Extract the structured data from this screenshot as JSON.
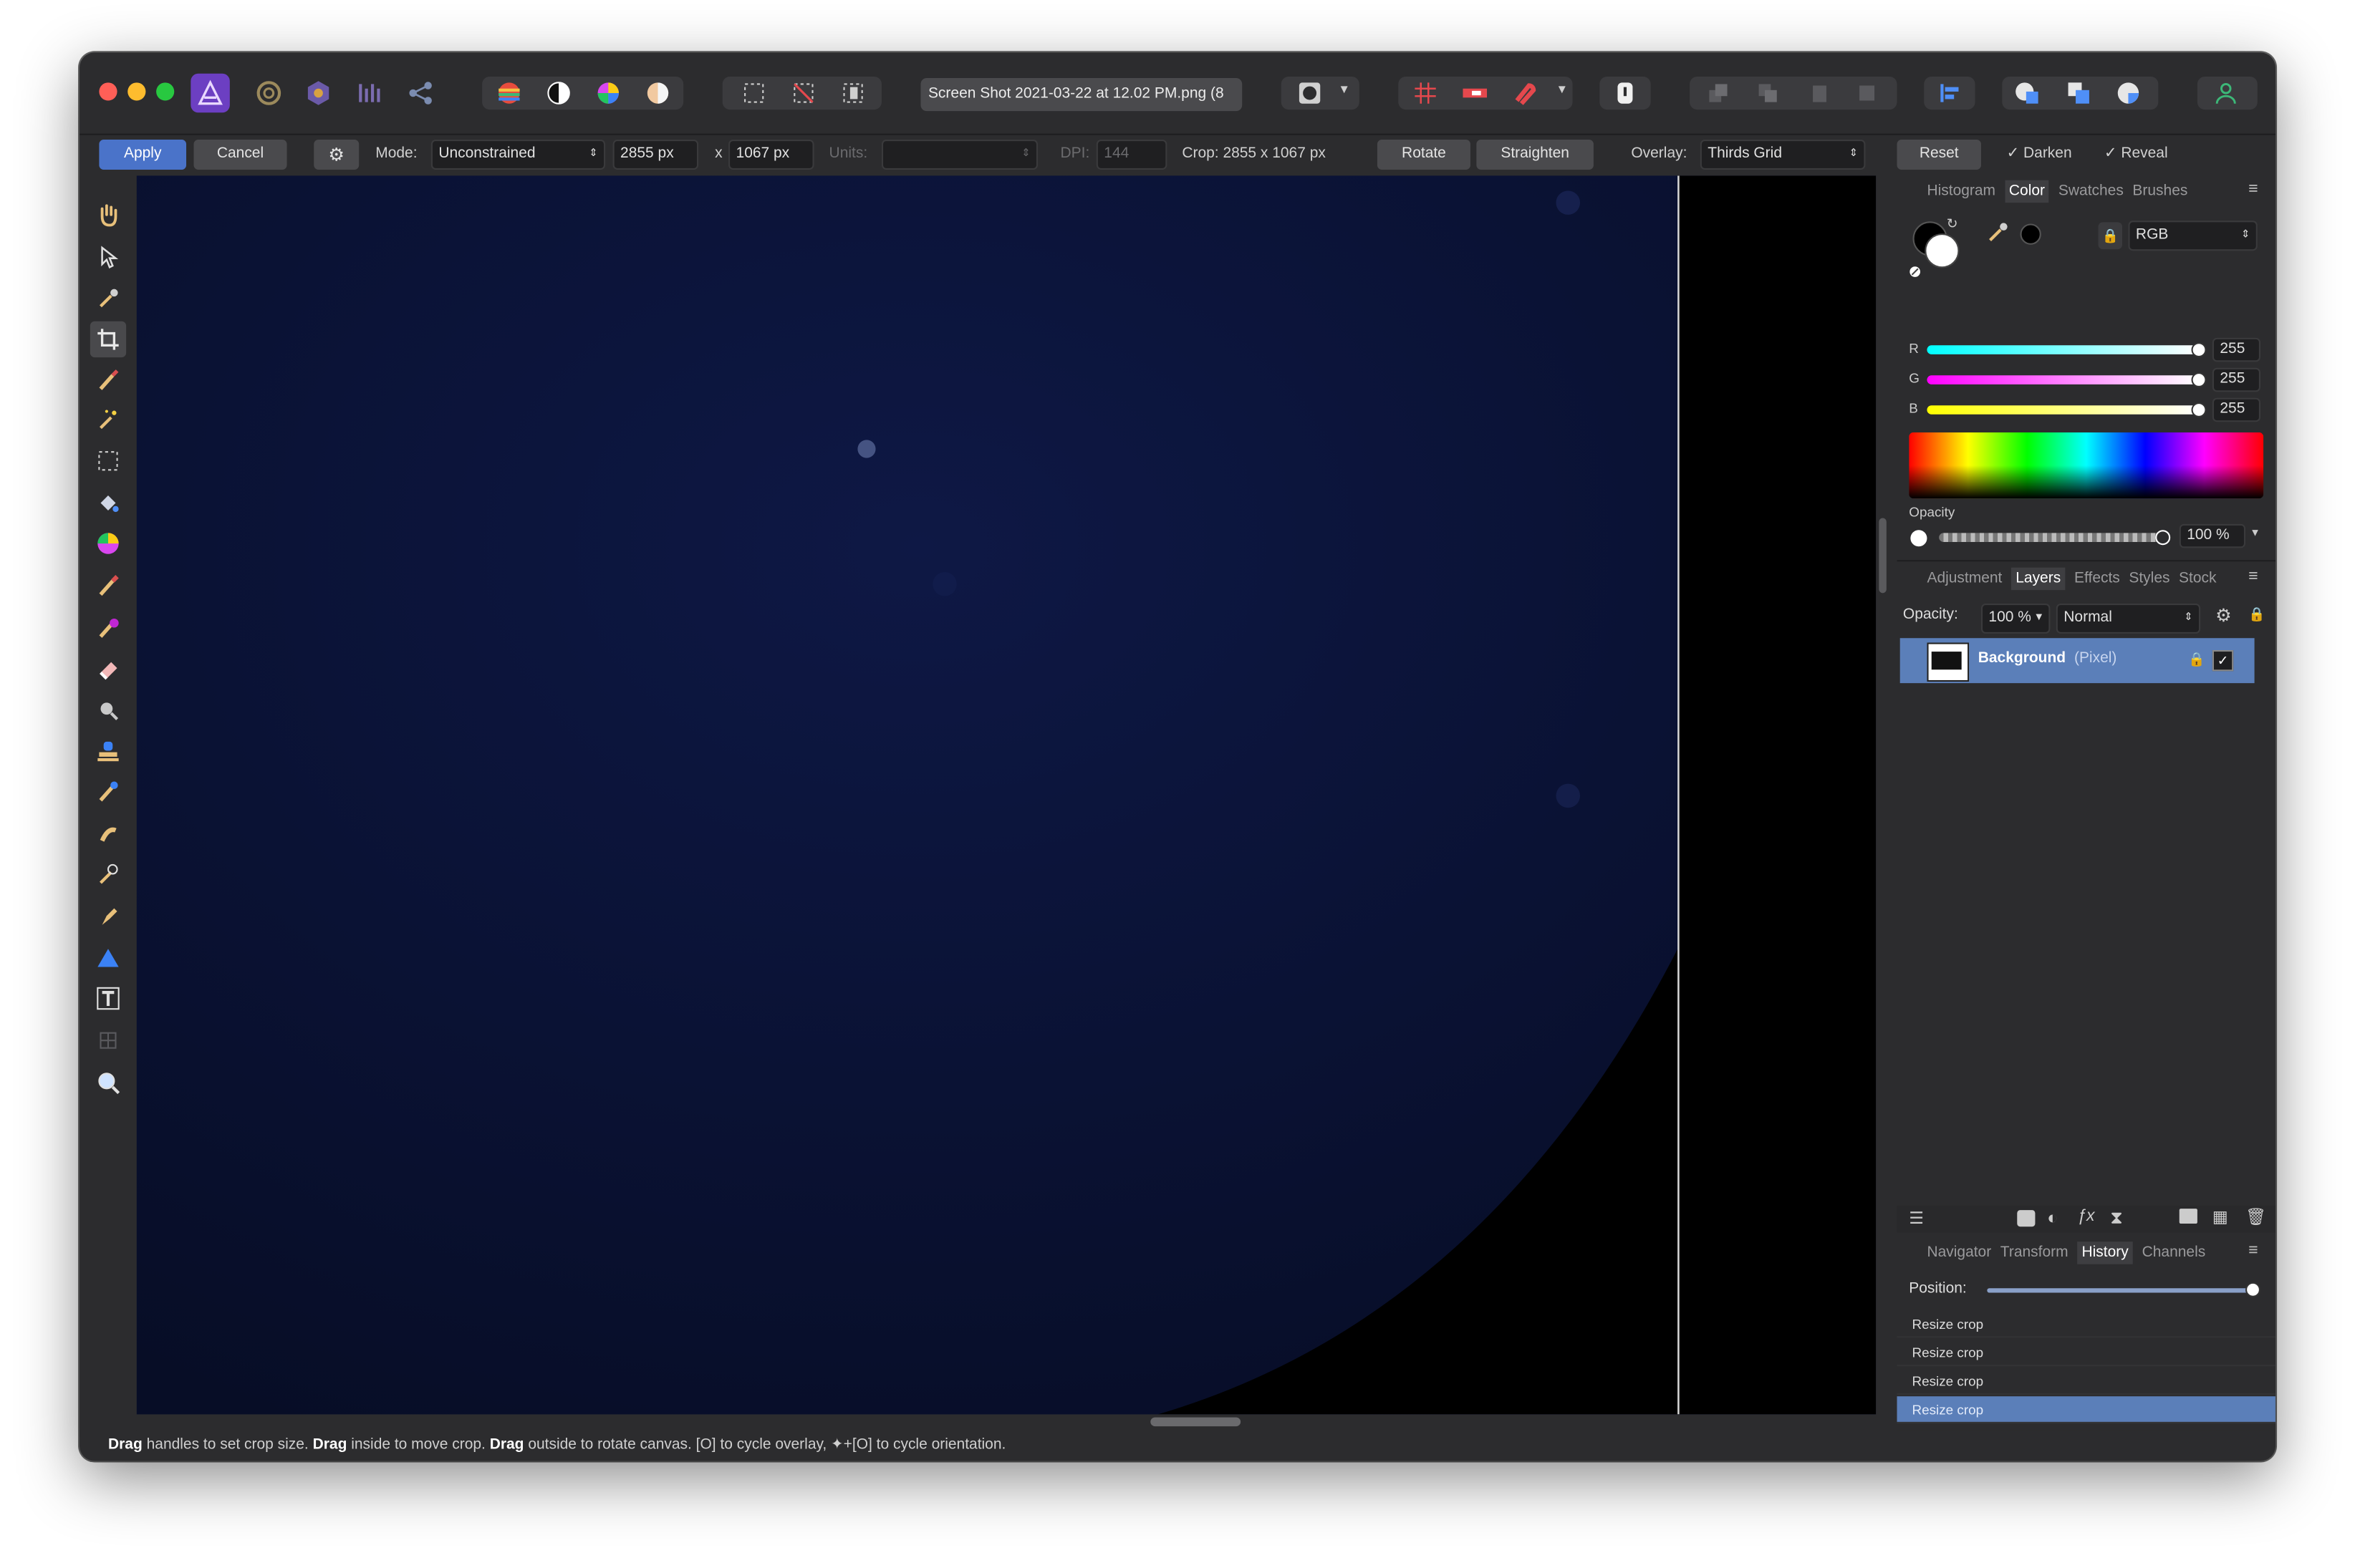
{
  "document_title": "Screen Shot 2021-03-22 at 12.02 PM.png (8",
  "context": {
    "apply": "Apply",
    "cancel": "Cancel",
    "mode_label": "Mode:",
    "mode_value": "Unconstrained",
    "width_value": "2855 px",
    "x_label": "x",
    "height_value": "1067 px",
    "units_label": "Units:",
    "dpi_label": "DPI:",
    "dpi_value": "144",
    "crop_info": "Crop:  2855 x 1067 px",
    "rotate": "Rotate",
    "straighten": "Straighten",
    "overlay_label": "Overlay:",
    "overlay_value": "Thirds Grid",
    "reset": "Reset",
    "darken": "Darken",
    "reveal": "Reveal"
  },
  "color_panel": {
    "tabs": [
      "Histogram",
      "Color",
      "Swatches",
      "Brushes"
    ],
    "selected_tab": "Color",
    "mode": "RGB",
    "channels": [
      {
        "label": "R",
        "value": "255"
      },
      {
        "label": "G",
        "value": "255"
      },
      {
        "label": "B",
        "value": "255"
      }
    ],
    "opacity_label": "Opacity",
    "opacity_value": "100 %"
  },
  "layers_panel": {
    "tabs": [
      "Adjustment",
      "Layers",
      "Effects",
      "Styles",
      "Stock"
    ],
    "selected_tab": "Layers",
    "opacity_label": "Opacity:",
    "opacity_value": "100 %",
    "blend_mode": "Normal",
    "layer_name": "Background",
    "layer_type": "(Pixel)"
  },
  "history_panel": {
    "tabs": [
      "Navigator",
      "Transform",
      "History",
      "Channels"
    ],
    "selected_tab": "History",
    "position_label": "Position:",
    "items": [
      "Resize crop",
      "Resize crop",
      "Resize crop",
      "Resize crop"
    ],
    "selected_index": 3
  },
  "status": {
    "b1": "Drag",
    "t1": " handles to set crop size. ",
    "b2": "Drag",
    "t2": " inside to move crop. ",
    "b3": "Drag",
    "t3": " outside to rotate canvas. [O] to cycle overlay, ✦+[O] to cycle orientation."
  },
  "colors": {
    "accent": "#5b7fb9",
    "canvas": "#0a1230",
    "window": "#2c2c2e"
  }
}
